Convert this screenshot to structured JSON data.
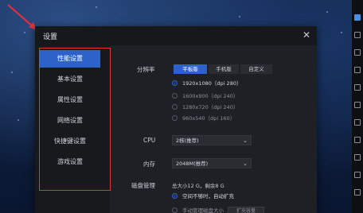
{
  "window": {
    "title": "设置",
    "close_glyph": "✕"
  },
  "sidebar": {
    "items": [
      {
        "label": "性能设置",
        "active": true
      },
      {
        "label": "基本设置"
      },
      {
        "label": "属性设置"
      },
      {
        "label": "网络设置"
      },
      {
        "label": "快捷键设置"
      },
      {
        "label": "游戏设置"
      }
    ]
  },
  "performance": {
    "resolution_label": "分辨率",
    "resolution_modes": [
      "平板版",
      "手机版",
      "自定义"
    ],
    "resolution_options": [
      {
        "label": "1920x1080（dpi 280）",
        "checked": true
      },
      {
        "label": "1600x900（dpi 240）"
      },
      {
        "label": "1280x720（dpi 240）"
      },
      {
        "label": "960x540（dpi 160）"
      }
    ],
    "cpu_label": "CPU",
    "cpu_value": "2核(推荐)",
    "memory_label": "内存",
    "memory_value": "2048M(推荐)",
    "disk_label": "磁盘管理",
    "disk_info": "总大小12 G，剩余8 G",
    "disk_option_auto": "空间不够时，自动扩充",
    "disk_option_manual": "手动管理磁盘大小",
    "expand_button": "扩充容量"
  },
  "colors": {
    "accent": "#2d62c9",
    "annotation": "#e0343c",
    "window_bg": "#1f2025"
  },
  "icons": [
    "close-icon",
    "chevron-down-icon",
    "annotation-arrow-icon"
  ]
}
